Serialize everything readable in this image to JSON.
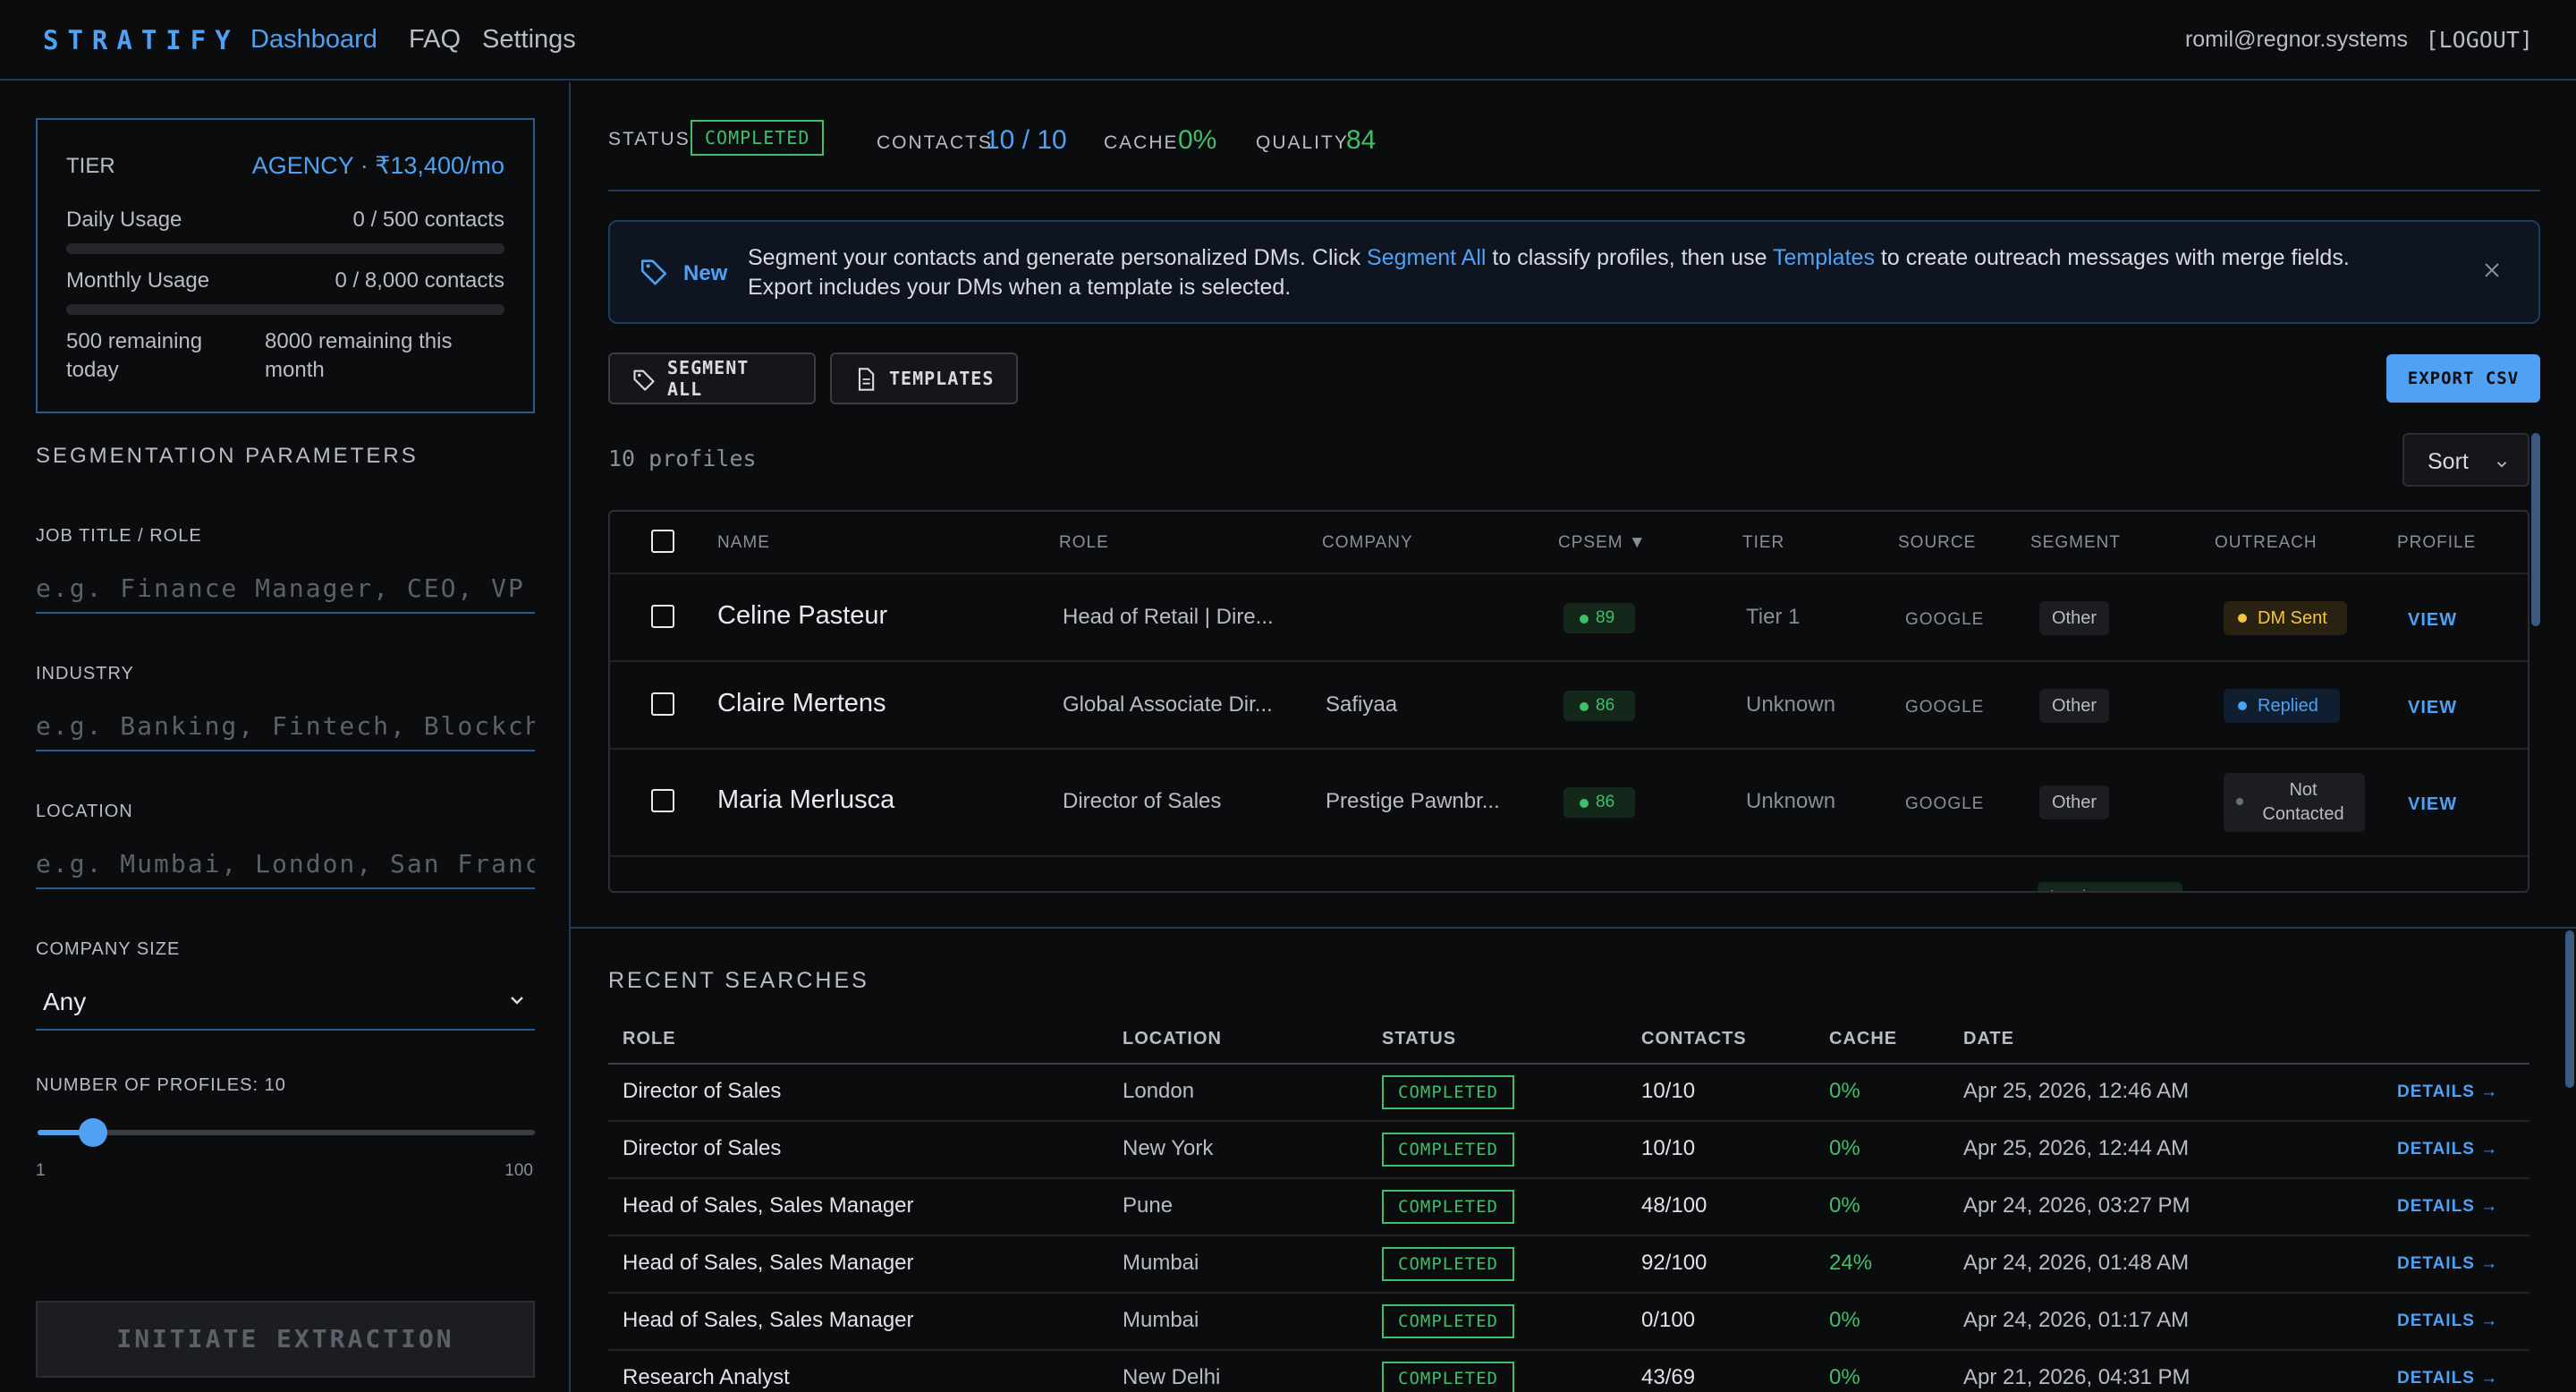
{
  "nav": {
    "brand": "STRATIFY",
    "links": [
      "Dashboard",
      "FAQ",
      "Settings"
    ],
    "user_email": "romil@regnor.systems",
    "logout": "[LOGOUT]"
  },
  "sidebar": {
    "tier": {
      "label": "TIER",
      "value": "AGENCY · ₹13,400/mo",
      "daily_label": "Daily Usage",
      "daily_value": "0 / 500 contacts",
      "daily_fraction": 0,
      "monthly_label": "Monthly Usage",
      "monthly_value": "0 / 8,000 contacts",
      "monthly_fraction": 0,
      "remaining_today": "500 remaining today",
      "remaining_month": "8000 remaining this month"
    },
    "heading": "SEGMENTATION PARAMETERS",
    "job_title": {
      "label": "JOB TITLE / ROLE",
      "placeholder": "e.g. Finance Manager, CEO, VP Sales"
    },
    "industry": {
      "label": "INDUSTRY",
      "placeholder": "e.g. Banking, Fintech, Blockchain"
    },
    "location": {
      "label": "LOCATION",
      "placeholder": "e.g. Mumbai, London, San Francisco"
    },
    "company_size": {
      "label": "COMPANY SIZE",
      "value": "Any"
    },
    "profiles": {
      "label": "NUMBER OF PROFILES: 10",
      "min": "1",
      "max": "100",
      "value": 10
    },
    "initiate": "INITIATE EXTRACTION"
  },
  "status_bar": {
    "status_label": "STATUS",
    "status_value": "COMPLETED",
    "contacts_label": "CONTACTS",
    "contacts_value": "10 / 10",
    "cache_label": "CACHE",
    "cache_value": "0%",
    "quality_label": "QUALITY",
    "quality_value": "84"
  },
  "banner": {
    "badge": "New",
    "text_1": "Segment your contacts and generate personalized DMs. Click ",
    "link_1": "Segment All",
    "text_2": " to classify profiles, then use ",
    "link_2": "Templates",
    "text_3": " to create outreach messages with merge fields.",
    "text_4": "Export includes your DMs when a template is selected."
  },
  "toolbar": {
    "segment_all": "SEGMENT ALL",
    "templates": "TEMPLATES",
    "export": "EXPORT CSV"
  },
  "profiles_count": "10 profiles",
  "sort_label": "Sort",
  "profile_table": {
    "headers": [
      "NAME",
      "ROLE",
      "COMPANY",
      "CPSEM ▼",
      "TIER",
      "SOURCE",
      "SEGMENT",
      "OUTREACH",
      "PROFILE"
    ],
    "rows": [
      {
        "name": "Celine Pasteur",
        "role": "Head of Retail | Dire...",
        "company": "",
        "score": "89",
        "tier": "Tier 1",
        "source": "GOOGLE",
        "segment": "Other",
        "outreach": "DM Sent",
        "outreach_color": "#f5c542",
        "view": "VIEW"
      },
      {
        "name": "Claire Mertens",
        "role": "Global Associate Dir...",
        "company": "Safiyaa",
        "score": "86",
        "tier": "Unknown",
        "source": "GOOGLE",
        "segment": "Other",
        "outreach": "Replied",
        "outreach_color": "#4ea1f3",
        "view": "VIEW"
      },
      {
        "name": "Maria Merlusca",
        "role": "Director of Sales",
        "company": "Prestige Pawnbr...",
        "score": "86",
        "tier": "Unknown",
        "source": "GOOGLE",
        "segment": "Other",
        "outreach": "Not Contacted",
        "outreach_color": "#6a6e76",
        "view": "VIEW"
      }
    ],
    "partial_row_segment": "Lead"
  },
  "recent": {
    "title": "RECENT SEARCHES",
    "headers": [
      "ROLE",
      "LOCATION",
      "STATUS",
      "CONTACTS",
      "CACHE",
      "DATE"
    ],
    "rows": [
      {
        "role": "Director of Sales",
        "location": "London",
        "status": "COMPLETED",
        "contacts": "10/10",
        "cache": "0%",
        "date": "Apr 25, 2026, 12:46 AM",
        "details": "DETAILS →"
      },
      {
        "role": "Director of Sales",
        "location": "New York",
        "status": "COMPLETED",
        "contacts": "10/10",
        "cache": "0%",
        "date": "Apr 25, 2026, 12:44 AM",
        "details": "DETAILS →"
      },
      {
        "role": "Head of Sales, Sales Manager",
        "location": "Pune",
        "status": "COMPLETED",
        "contacts": "48/100",
        "cache": "0%",
        "date": "Apr 24, 2026, 03:27 PM",
        "details": "DETAILS →"
      },
      {
        "role": "Head of Sales, Sales Manager",
        "location": "Mumbai",
        "status": "COMPLETED",
        "contacts": "92/100",
        "cache": "24%",
        "date": "Apr 24, 2026, 01:48 AM",
        "details": "DETAILS →"
      },
      {
        "role": "Head of Sales, Sales Manager",
        "location": "Mumbai",
        "status": "COMPLETED",
        "contacts": "0/100",
        "cache": "0%",
        "date": "Apr 24, 2026, 01:17 AM",
        "details": "DETAILS →"
      },
      {
        "role": "Research Analyst",
        "location": "New Delhi",
        "status": "COMPLETED",
        "contacts": "43/69",
        "cache": "0%",
        "date": "Apr 21, 2026, 04:31 PM",
        "details": "DETAILS →"
      }
    ]
  },
  "colors": {
    "accent": "#4ea1f3",
    "success": "#3fbf6a",
    "background": "#0b0c0e",
    "border": "#1f3a5a"
  }
}
